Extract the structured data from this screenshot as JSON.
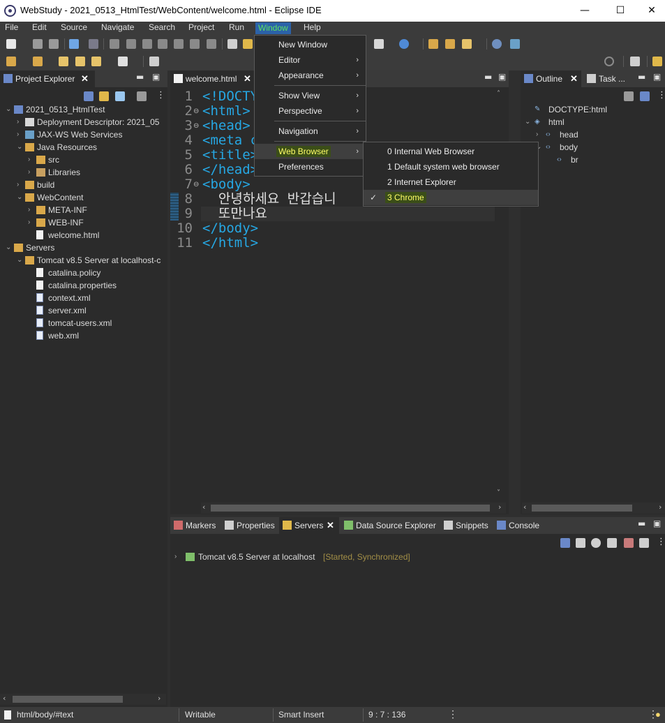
{
  "window": {
    "title": "WebStudy - 2021_0513_HtmlTest/WebContent/welcome.html - Eclipse IDE",
    "minimize": "—",
    "maximize": "☐",
    "close": "✕"
  },
  "menubar": [
    "File",
    "Edit",
    "Source",
    "Navigate",
    "Search",
    "Project",
    "Run",
    "Window",
    "Help"
  ],
  "project_explorer": {
    "tab_label": "Project Explorer",
    "tree": [
      {
        "label": "2021_0513_HtmlTest",
        "depth": 0,
        "twisty": "open",
        "icon": "project-icon"
      },
      {
        "label": "Deployment Descriptor: 2021_05",
        "depth": 1,
        "twisty": "closed",
        "icon": "descriptor-icon"
      },
      {
        "label": "JAX-WS Web Services",
        "depth": 1,
        "twisty": "closed",
        "icon": "webservice-icon"
      },
      {
        "label": "Java Resources",
        "depth": 1,
        "twisty": "open",
        "icon": "java-resources-icon"
      },
      {
        "label": "src",
        "depth": 2,
        "twisty": "closed",
        "icon": "package-folder-icon"
      },
      {
        "label": "Libraries",
        "depth": 2,
        "twisty": "closed",
        "icon": "library-icon"
      },
      {
        "label": "build",
        "depth": 1,
        "twisty": "closed",
        "icon": "folder-icon"
      },
      {
        "label": "WebContent",
        "depth": 1,
        "twisty": "open",
        "icon": "folder-icon"
      },
      {
        "label": "META-INF",
        "depth": 2,
        "twisty": "closed",
        "icon": "folder-icon"
      },
      {
        "label": "WEB-INF",
        "depth": 2,
        "twisty": "closed",
        "icon": "folder-icon"
      },
      {
        "label": "welcome.html",
        "depth": 2,
        "twisty": "none",
        "icon": "html-file-icon"
      },
      {
        "label": "Servers",
        "depth": 0,
        "twisty": "open",
        "icon": "folder-icon"
      },
      {
        "label": "Tomcat v8.5 Server at localhost-c",
        "depth": 1,
        "twisty": "open",
        "icon": "folder-icon"
      },
      {
        "label": "catalina.policy",
        "depth": 2,
        "twisty": "none",
        "icon": "file-icon"
      },
      {
        "label": "catalina.properties",
        "depth": 2,
        "twisty": "none",
        "icon": "file-icon"
      },
      {
        "label": "context.xml",
        "depth": 2,
        "twisty": "none",
        "icon": "xml-file-icon"
      },
      {
        "label": "server.xml",
        "depth": 2,
        "twisty": "none",
        "icon": "xml-file-icon"
      },
      {
        "label": "tomcat-users.xml",
        "depth": 2,
        "twisty": "none",
        "icon": "xml-file-icon"
      },
      {
        "label": "web.xml",
        "depth": 2,
        "twisty": "none",
        "icon": "xml-file-icon"
      }
    ]
  },
  "editor": {
    "tab_label": "welcome.html",
    "lines": [
      {
        "n": "1",
        "fold": "",
        "html": "<!DOCTY"
      },
      {
        "n": "2",
        "fold": "⊖",
        "html": "<html>"
      },
      {
        "n": "3",
        "fold": "⊖",
        "html": "<head>"
      },
      {
        "n": "4",
        "fold": "",
        "html": "<meta c"
      },
      {
        "n": "5",
        "fold": "",
        "html": "<title>"
      },
      {
        "n": "6",
        "fold": "",
        "html": "</head>"
      },
      {
        "n": "7",
        "fold": "⊖",
        "html": "<body>"
      },
      {
        "n": "8",
        "fold": "",
        "html": "  안녕하세요 반갑습니"
      },
      {
        "n": "9",
        "fold": "",
        "html": "  또만나요"
      },
      {
        "n": "10",
        "fold": "",
        "html": "</body>"
      },
      {
        "n": "11",
        "fold": "",
        "html": "</html>"
      }
    ]
  },
  "window_menu": {
    "items": [
      {
        "label": "New Window",
        "submenu": false
      },
      {
        "label": "Editor",
        "submenu": true
      },
      {
        "label": "Appearance",
        "submenu": true
      },
      {
        "label": "Show View",
        "submenu": true
      },
      {
        "label": "Perspective",
        "submenu": true
      },
      {
        "label": "Navigation",
        "submenu": true
      },
      {
        "label": "Web Browser",
        "submenu": true
      },
      {
        "label": "Preferences",
        "submenu": false
      }
    ]
  },
  "web_browser_submenu": {
    "items": [
      {
        "label": "0 Internal Web Browser",
        "checked": false
      },
      {
        "label": "1 Default system web browser",
        "checked": false
      },
      {
        "label": "2 Internet Explorer",
        "checked": false
      },
      {
        "label": "3 Chrome",
        "checked": true
      }
    ],
    "check_glyph": "✓"
  },
  "outline": {
    "tab_label": "Outline",
    "task_tab_label": "Task ...",
    "tree": [
      {
        "label": "DOCTYPE:html",
        "depth": 0,
        "twisty": "none"
      },
      {
        "label": "html",
        "depth": 0,
        "twisty": "open"
      },
      {
        "label": "head",
        "depth": 1,
        "twisty": "closed"
      },
      {
        "label": "body",
        "depth": 1,
        "twisty": "open"
      },
      {
        "label": "br",
        "depth": 2,
        "twisty": "none"
      }
    ]
  },
  "bottom_panel": {
    "tabs": [
      "Markers",
      "Properties",
      "Servers",
      "Data Source Explorer",
      "Snippets",
      "Console"
    ],
    "server_row": {
      "label": "Tomcat v8.5 Server at localhost",
      "state": "[Started, Synchronized]"
    }
  },
  "statusbar": {
    "path": "html/body/#text",
    "writable": "Writable",
    "insert_mode": "Smart Insert",
    "position": "9 : 7 : 136"
  },
  "colors": {
    "tag": "#26a7e3",
    "menu_highlight_bg": "#2c62a8",
    "menu_highlight_fg": "#5ee25e",
    "submenu_highlight_fg": "#ffff66",
    "server_state": "#a38f47"
  }
}
